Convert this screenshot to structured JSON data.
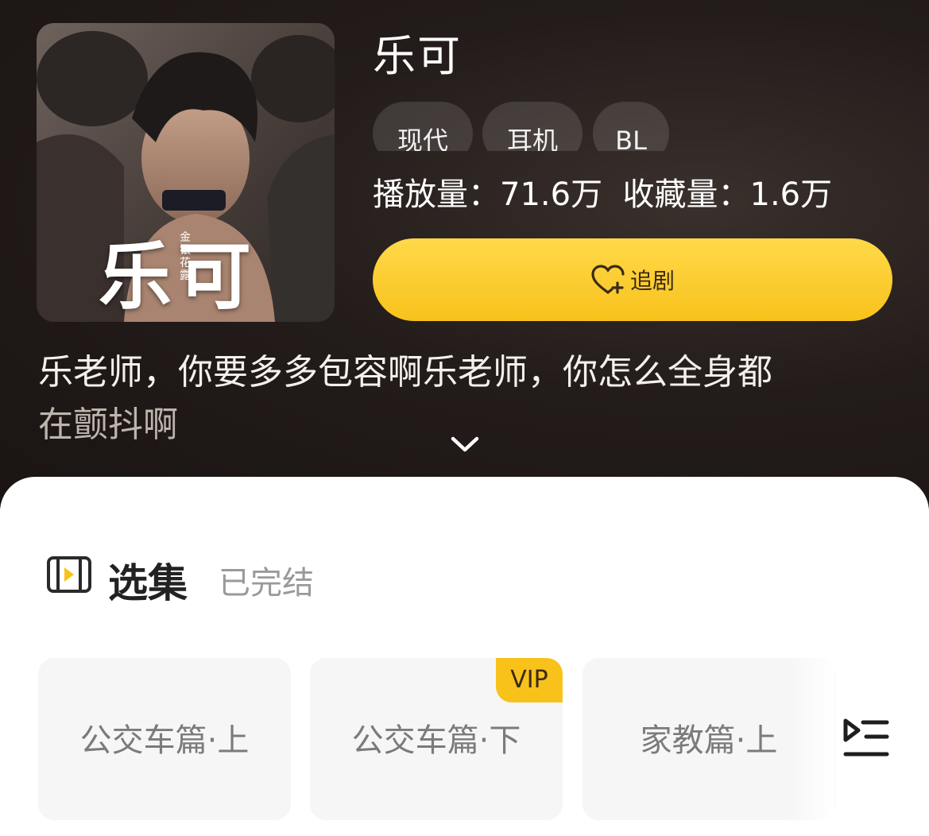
{
  "drama": {
    "title": "乐可",
    "cover_text": "乐可",
    "cover_seal": "金银花露",
    "tags": [
      "现代",
      "耳机",
      "BL"
    ],
    "plays_label": "播放量：",
    "plays_value": "71.6万",
    "favorites_label": "收藏量：",
    "favorites_value": "1.6万",
    "follow_label": "追剧",
    "description_line1": "乐老师，你要多多包容啊乐老师，你怎么全身都",
    "description_line2": "在颤抖啊"
  },
  "episodes_section": {
    "title": "选集",
    "status": "已完结",
    "episodes": [
      {
        "label": "公交车篇·上",
        "badge": ""
      },
      {
        "label": "公交车篇·下",
        "badge": "VIP"
      },
      {
        "label": "家教篇·上",
        "badge": ""
      }
    ]
  },
  "icons": {
    "follow": "heart-plus-icon",
    "expand": "chevron-down-icon",
    "section": "film-play-icon",
    "list": "playlist-icon"
  },
  "colors": {
    "accent": "#f8c21b",
    "hero_background": "#231c1a",
    "sheet_background": "#ffffff"
  }
}
